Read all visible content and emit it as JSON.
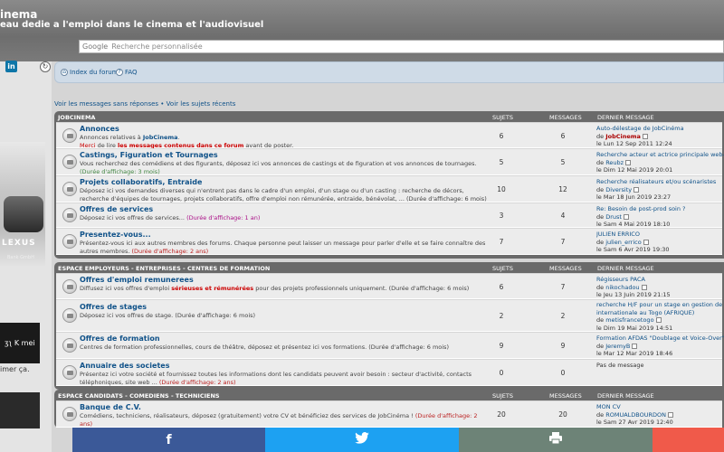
{
  "header": {
    "title": "inema",
    "tagline": "eau dedie a l'emploi dans le cinema et l'audiovisuel",
    "search_brand": "Google",
    "search_placeholder": "Recherche personnalisée"
  },
  "sidebar": {
    "linkedin": "in",
    "ad_brand": "LEXUS",
    "ad_sub": "Bank GmbH",
    "ad2_text": "ʒʅ K mei",
    "ad_caption": "imer ça."
  },
  "nav": {
    "index": "Index du forum",
    "faq": "FAQ"
  },
  "quick_links": {
    "unanswered": "Voir les messages sans réponses",
    "sep": " • ",
    "active": "Voir les sujets récents"
  },
  "columns": {
    "subjects": "SUJETS",
    "messages": "MESSAGES",
    "last": "DERNIER MESSAGE"
  },
  "categories": [
    {
      "name": "JOBCINEMA",
      "forums": [
        {
          "title": "Annonces",
          "desc1": "Annonces relatives à ",
          "desc1b": "JobCinema",
          "desc1c": ".",
          "desc2a": "Merci",
          "desc2b": " de lire ",
          "desc2c": "les messages contenus dans ce forum",
          "desc2d": " avant de poster.",
          "subjects": "6",
          "messages": "6",
          "last_title": "Auto-délestage de JobCinéma",
          "last_by": "de ",
          "last_author": "JobCinema",
          "last_date": "le Lun 12 Sep 2011 12:24"
        },
        {
          "title": "Castings, Figuration et Tournages",
          "desc1": "Vous recherchez des comédiens et des figurants, déposez ici vos annonces de castings et de figuration et vos annonces de tournages.",
          "desc2": "(Durée d'affichage: 3 mois)",
          "subjects": "5",
          "messages": "5",
          "last_title": "Recherche acteur et actrice principale web-se",
          "last_by": "de ",
          "last_author": "Reubz",
          "last_date": "le Dim 12 Mai 2019 20:01"
        },
        {
          "title": "Projets collaboratifs, Entraide",
          "desc1": "Déposez ici vos demandes diverses qui n'entrent pas dans le cadre d'un emploi, d'un stage ou d'un casting : recherche de décors,",
          "desc2": "recherche d'équipes de tournages, projets collaboratifs, offre d'emploi non rémunérée, entraide, bénévolat, ...",
          "desc2b": " (Durée d'affichage: 6 mois)",
          "subjects": "10",
          "messages": "12",
          "last_title": "Recherche réalisateurs et/ou scénaristes",
          "last_by": "de ",
          "last_author": "Diversity",
          "last_date": "le Mar 18 Jun 2019 23:27"
        },
        {
          "title": "Offres de services",
          "desc1": "Déposez ici vos offres de services...",
          "desc1b": " (Durée d'affichage: 1 an)",
          "subjects": "3",
          "messages": "4",
          "last_title": "Re: Besoin de post-prod soin ?",
          "last_by": "de ",
          "last_author": "Drust",
          "last_date": "le Sam 4 Mai 2019 18:10"
        },
        {
          "title": "Presentez-vous...",
          "desc1": "Présentez-vous ici aux autres membres des forums. Chaque personne peut laisser un message pour parler d'elle et se faire connaître des",
          "desc2": "autres membres.",
          "desc2b": " (Durée d'affichage: 2 ans)",
          "subjects": "7",
          "messages": "7",
          "last_title": "JULIEN ERRICO",
          "last_by": "de ",
          "last_author": "julien_errico",
          "last_date": "le Sam 6 Avr 2019 19:30"
        }
      ]
    },
    {
      "name": "ESPACE EMPLOYEURS - ENTREPRISES - CENTRES DE FORMATION",
      "forums": [
        {
          "title": "Offres d'emploi remunerees",
          "desc1": "Diffusez ici vos offres d'emploi ",
          "desc1b": "sérieuses et rémunérées",
          "desc1c": " pour des projets professionnels uniquement.",
          "desc1d": " (Durée d'affichage: 6 mois)",
          "subjects": "6",
          "messages": "7",
          "last_title": "Régisseurs PACA",
          "last_by": "de ",
          "last_author": "nikochadou",
          "last_date": "le Jeu 13 Juin 2019 21:15"
        },
        {
          "title": "Offres de stages",
          "desc1": "Déposez ici vos offres de stage.",
          "desc1b": " (Durée d'affichage: 6 mois)",
          "subjects": "2",
          "messages": "2",
          "last_title": "recherche H/F pour un stage en gestion de pr",
          "last_title2": "internationale au Togo (AFRIQUE)",
          "last_by": "de ",
          "last_author": "metisfrancetogo",
          "last_date": "le Dim 19 Mai 2019 14:51"
        },
        {
          "title": "Offres de formation",
          "desc1": "Centres de formation professionnelles, cours de théâtre, déposez et présentez ici vos formations.",
          "desc1b": " (Durée d'affichage: 6 mois)",
          "subjects": "9",
          "messages": "9",
          "last_title": "Formation AFDAS \"Doublage et Voice-Over\"",
          "last_by": "de ",
          "last_author": "JeremyB",
          "last_date": "le Mar 12 Mar 2019 18:46"
        },
        {
          "title": "Annuaire des societes",
          "desc1": "Présentez ici votre société et fournissez toutes les informations dont les candidats peuvent avoir besoin : secteur d'activité, contacts",
          "desc2": "téléphoniques, site web ...",
          "desc2b": " (Durée d'affichage: 2 ans)",
          "subjects": "0",
          "messages": "0",
          "last_title": "Pas de message",
          "last_by": "",
          "last_author": "",
          "last_date": ""
        }
      ]
    },
    {
      "name": "ESPACE CANDIDATS - COMEDIENS - TECHNICIENS",
      "forums": [
        {
          "title": "Banque de C.V.",
          "desc1": "Comédiens, techniciens, réalisateurs, déposez (gratuitement) votre CV et bénéficiez des services de JobCinéma !",
          "desc1b": " (Durée d'affichage: 2 ans)",
          "subjects": "20",
          "messages": "20",
          "last_title": "MON CV",
          "last_by": "de ",
          "last_author": "ROMUALDBOURDON",
          "last_date": "le Sam 27 Avr 2019 12:40"
        }
      ]
    }
  ],
  "share": {
    "facebook": "f",
    "twitter": "🐦",
    "print": "🖶",
    "mail": ""
  }
}
